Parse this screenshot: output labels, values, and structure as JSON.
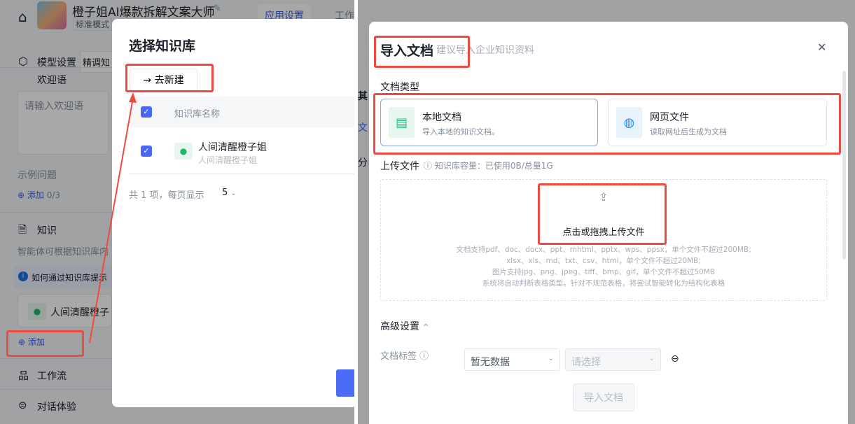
{
  "left": {
    "app_title": "橙子姐AI爆款拆解文案大师",
    "mode_badge": "标准模式",
    "tab_app_settings": "应用设置",
    "tab_workflow": "工作",
    "model_settings": "模型设置",
    "finetune": "精调知",
    "welcome_label": "欢迎语",
    "welcome_placeholder": "请输入欢迎语",
    "example_questions": "示例问题",
    "add": "添加",
    "add_count": "0/3",
    "knowledge": "知识",
    "knowledge_desc": "智能体可根据知识库内",
    "tip": "如何通过知识库提示",
    "kb_item": "人间清醒橙子",
    "add_kb": "添加",
    "workflow": "工作流",
    "chat_experience": "对话体验",
    "modal": {
      "title": "选择知识库",
      "create_button": "去新建",
      "col_name": "知识库名称",
      "rows": [
        {
          "name": "人间清醒橙子姐",
          "desc": "人间清醒橙子姐"
        }
      ],
      "pagination_text": "共 1 项，每页显示",
      "page_size": "5"
    }
  },
  "right": {
    "bg_texts": [
      "其",
      "文",
      "分"
    ],
    "modal": {
      "title": "导入文档",
      "subtitle": "建议导入企业知识资料",
      "doc_type_label": "文档类型",
      "types": [
        {
          "title": "本地文档",
          "desc": "导入本地的知识文档。"
        },
        {
          "title": "网页文件",
          "desc": "读取网址后生成为文档"
        }
      ],
      "upload_label": "上传文件",
      "capacity": "知识库容量：已使用0B/总量1G",
      "upload_action": "点击或拖拽上传文件",
      "upload_hints": [
        "文档支持pdf、doc、docx、ppt、mhtml、pptx、wps、ppsx，单个文件不超过200MB;",
        "xlsx、xls、md、txt、csv、html，单个文件不超过20MB;",
        "图片支持jpg、png、jpeg、tiff、bmp、gif，单个文件不超过50MB",
        "系统将自动判断表格类型，针对不规范表格，将尝试智能转化为结构化表格"
      ],
      "advanced": "高级设置",
      "doc_tag_label": "文档标签",
      "tag_select_value": "暂无数据",
      "tag_value_placeholder": "请选择",
      "import_button": "导入文档"
    }
  },
  "colors": {
    "annotation": "#ef4a3f",
    "primary": "#4a67f5"
  }
}
